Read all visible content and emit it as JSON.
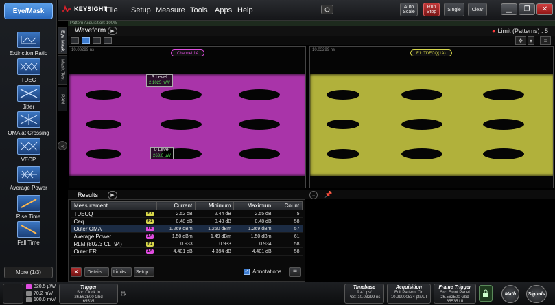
{
  "app": {
    "mode_button": "Eye/Mask",
    "brand": "KEYSIGHT",
    "menu": [
      "File",
      "Setup",
      "Measure",
      "Tools",
      "Apps",
      "Help"
    ],
    "top_buttons": {
      "auto_scale": "Auto Scale",
      "run_stop": "Run Stop",
      "single": "Single",
      "clear": "Clear"
    }
  },
  "sidebar": {
    "measurements": [
      {
        "label": "Extinction Ratio",
        "icon": "extinction-ratio-icon"
      },
      {
        "label": "TDEC",
        "icon": "tdec-icon"
      },
      {
        "label": "Jitter",
        "icon": "jitter-icon"
      },
      {
        "label": "OMA at Crossing",
        "icon": "oma-crossing-icon"
      },
      {
        "label": "VECP",
        "icon": "vecp-icon"
      },
      {
        "label": "Average Power",
        "icon": "average-power-icon"
      },
      {
        "label": "Rise Time",
        "icon": "rise-time-icon"
      },
      {
        "label": "Fall Time",
        "icon": "fall-time-icon"
      }
    ],
    "more_label": "More (1/3)",
    "vertical_tabs": [
      "Eye Mask",
      "Mask Test",
      "PAM"
    ]
  },
  "waveform": {
    "pattern_strip": "Pattern Acquisition: 100%",
    "title": "Waveform",
    "limit_status": "Limit (Patterns) : 5",
    "left_panel": {
      "timestamp": "10.03299 ns",
      "badge": "Channel 1A",
      "upper_level_label": "3 Level",
      "upper_level_value": "2.1025 mW",
      "lower_level_label": "0 Level",
      "lower_level_value": "263.0 µW"
    },
    "right_panel": {
      "timestamp": "10.03299 ns",
      "badge": "F1: TDECQ(1A)"
    }
  },
  "colors": {
    "accent": "#3d7cd0",
    "channel_a": "#e04ce0",
    "function_1": "#d8d84a",
    "run_stop": "#c43a3a"
  },
  "results": {
    "title": "Results",
    "columns": [
      "Measurement",
      "Current",
      "Minimum",
      "Maximum",
      "Count"
    ],
    "rows": [
      {
        "name": "TDECQ",
        "src": "F1",
        "current": "2.52 dB",
        "minimum": "2.44 dB",
        "maximum": "2.55 dB",
        "count": "5"
      },
      {
        "name": "Ceq",
        "src": "F1",
        "current": "0.48 dB",
        "minimum": "0.48 dB",
        "maximum": "0.48 dB",
        "count": "58"
      },
      {
        "name": "Outer OMA",
        "src": "1A",
        "current": "1.269 dBm",
        "minimum": "1.260 dBm",
        "maximum": "1.269 dBm",
        "count": "57"
      },
      {
        "name": "Average Power",
        "src": "1A",
        "current": "1.50 dBm",
        "minimum": "1.49 dBm",
        "maximum": "1.50 dBm",
        "count": "61"
      },
      {
        "name": "RLM (802.3 CL_94)",
        "src": "F1",
        "current": "0.933",
        "minimum": "0.933",
        "maximum": "0.934",
        "count": "58"
      },
      {
        "name": "Outer ER",
        "src": "1A",
        "current": "4.401 dB",
        "minimum": "4.394 dB",
        "maximum": "4.401 dB",
        "count": "58"
      }
    ],
    "toolbar": {
      "details": "Details...",
      "limits": "Limits...",
      "setup": "Setup...",
      "annotations": "Annotations"
    }
  },
  "status": {
    "scales": [
      "320.5 µW/",
      "70.2 mV/",
      "100.0 mV/"
    ],
    "trigger": {
      "title": "Trigger",
      "lines": [
        "Src: Clock In",
        "26.562500 Gbd",
        "65535"
      ]
    },
    "timebase": {
      "title": "Timebase",
      "lines": [
        "9.41 ps/",
        "Pos: 10.03299 ns"
      ]
    },
    "acquisition": {
      "title": "Acquisition",
      "lines": [
        "Full Pattern: On",
        "10.99000534 pts/UI"
      ]
    },
    "frame_trigger": {
      "title": "Frame Trigger",
      "lines": [
        "Src: Front Panel",
        "26.562500 Gbd",
        "65535 UI"
      ]
    },
    "math_label": "Math",
    "signals_label": "Signals"
  }
}
